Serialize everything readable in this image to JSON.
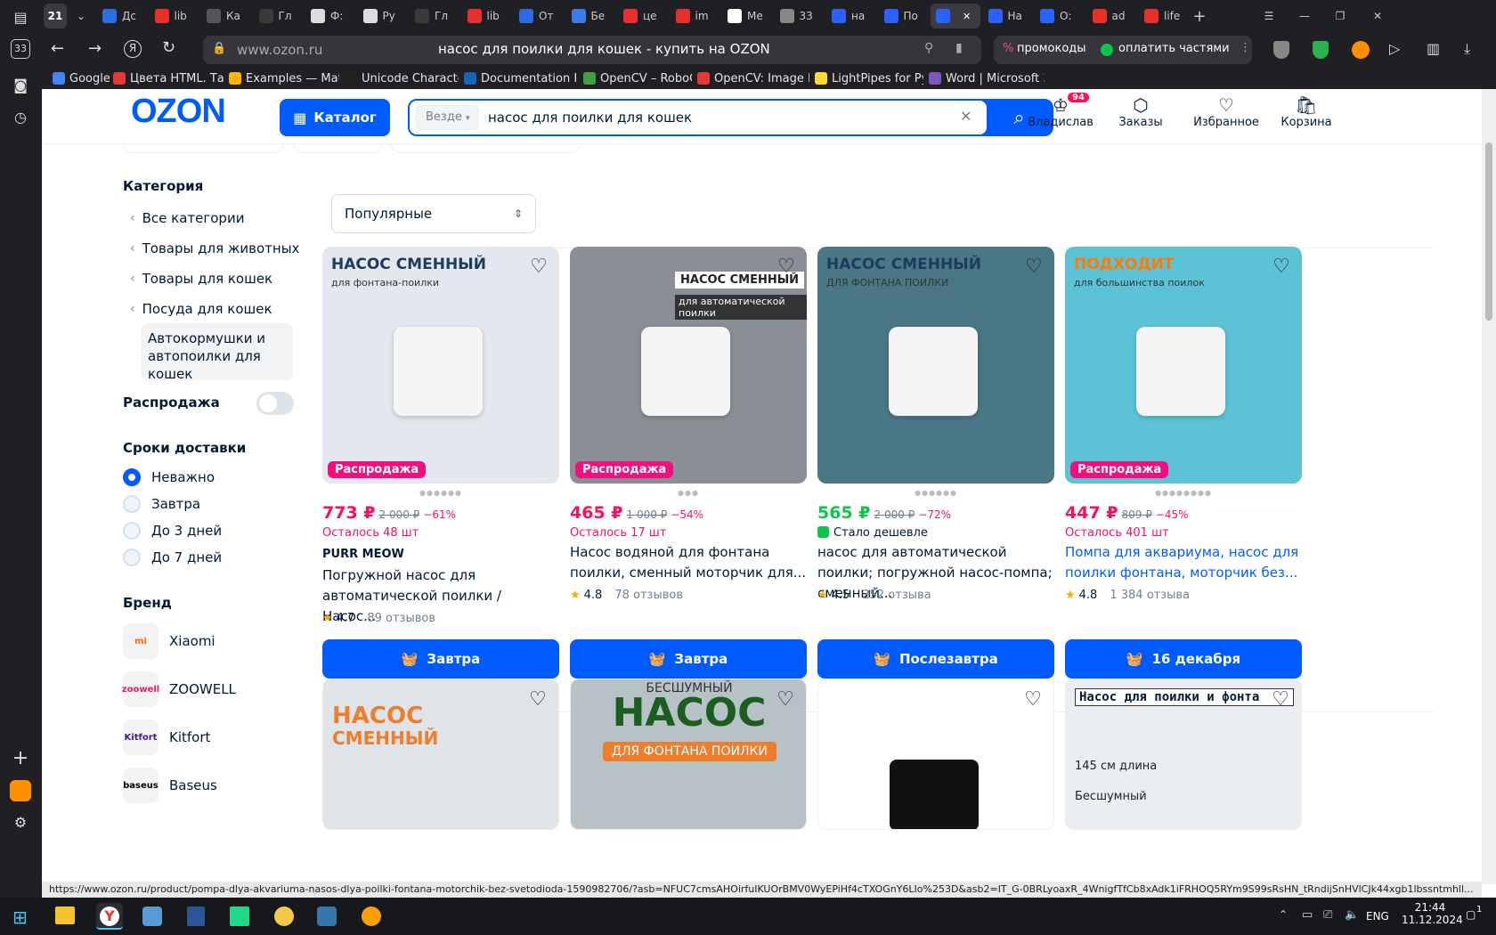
{
  "browser": {
    "tab_count": "21",
    "tabs": [
      {
        "label": "Дс",
        "color": "#2b6fe0"
      },
      {
        "label": "lib",
        "color": "#e5302e"
      },
      {
        "label": "Ка",
        "color": "#555"
      },
      {
        "label": "Гл",
        "color": "#3a3a3a"
      },
      {
        "label": "Ф:",
        "color": "#ddd"
      },
      {
        "label": "Ру",
        "color": "#ddd"
      },
      {
        "label": "Гл",
        "color": "#3a3a3a"
      },
      {
        "label": "lib",
        "color": "#e5302e"
      },
      {
        "label": "От",
        "color": "#2d6cdf"
      },
      {
        "label": "Бе",
        "color": "#3d7be8"
      },
      {
        "label": "це",
        "color": "#e5302e"
      },
      {
        "label": "im",
        "color": "#e5302e"
      },
      {
        "label": "Ме",
        "color": "#fff"
      },
      {
        "label": "33",
        "color": "#888"
      },
      {
        "label": "на",
        "color": "#2962ff"
      },
      {
        "label": "По",
        "color": "#2962ff"
      },
      {
        "label": "",
        "color": "#2962ff"
      },
      {
        "label": "На",
        "color": "#2962ff"
      },
      {
        "label": "О:",
        "color": "#2962ff"
      },
      {
        "label": "ad",
        "color": "#e5302e"
      },
      {
        "label": "life",
        "color": "#e5302e"
      }
    ],
    "domain": "www.ozon.ru",
    "page_title": "насос для поилки для кошек - купить на OZON",
    "promo_label": "промокоды",
    "pay_label": "оплатить частями",
    "bookmarks": [
      {
        "label": "Google",
        "color": "#4285f4"
      },
      {
        "label": "Цвета HTML. Табл",
        "color": "#e53935"
      },
      {
        "label": "Examples — Matpl",
        "color": "#ffb300"
      },
      {
        "label": "Unicode Character",
        "color": "#222"
      },
      {
        "label": "Documentation Int",
        "color": "#1565c0"
      },
      {
        "label": "OpenCV – RoboCr",
        "color": "#43a047"
      },
      {
        "label": "OpenCV: Image Fil",
        "color": "#e53935"
      },
      {
        "label": "LightPipes for Pyth",
        "color": "#fdd835"
      },
      {
        "label": "Word | Microsoft 3",
        "color": "#7e57c2"
      }
    ],
    "status_url": "https://www.ozon.ru/product/pompa-dlya-akvariuma-nasos-dlya-poilki-fontana-motorchik-bez-svetodioda-1590982706/?asb=NFUC7cmsAHOirfuIKUOrBMV0WyEPiHf4cTXOGnY6LIo%253D&asb2=IT_G-0BRLyoaxR_4WnigfTfCb8xAdk1iFRHOQ5RYm9S99sRsHN_tRndijSnHVlCJk44xgb1lbssntmhll...",
    "side_badge": "33"
  },
  "header": {
    "logo": "OZON",
    "catalog": "Каталог",
    "scope": "Везде",
    "search_value": "насос для поилки для кошек",
    "user": "Владислав",
    "user_badge": "94",
    "orders": "Заказы",
    "favorites": "Избранное",
    "cart": "Корзина"
  },
  "filters": {
    "category_title": "Категория",
    "categories": [
      "Все категории",
      "Товары для животных",
      "Товары для кошек",
      "Посуда для кошек"
    ],
    "current_category": "Автокормушки и автопоилки для кошек",
    "sale_label": "Распродажа",
    "delivery_title": "Сроки доставки",
    "delivery_options": [
      "Неважно",
      "Завтра",
      "До 3 дней",
      "До 7 дней"
    ],
    "brand_title": "Бренд",
    "brands": [
      {
        "name": "Xiaomi",
        "logo": "mi",
        "color": "#ff6900"
      },
      {
        "name": "ZOOWELL",
        "logo": "zoowell",
        "color": "#e91e63"
      },
      {
        "name": "Kitfort",
        "logo": "Kitfort",
        "color": "#4a148c"
      },
      {
        "name": "Baseus",
        "logo": "baseus",
        "color": "#000"
      }
    ]
  },
  "sort": {
    "selected": "Популярные"
  },
  "products": [
    {
      "price": "773 ₽",
      "old": "2 000 ₽",
      "disc": "−61%",
      "price_color": "#f91155",
      "left": "Осталось 48 шт",
      "brand": "PURR MEOW",
      "title": "Погружной насос для автоматической поилки / Насос...",
      "rating": "4.7",
      "reviews": "89 отзывов",
      "deliver": "Завтра",
      "sale": "Распродажа",
      "img_text": "НАСОС СМЕННЫЙ",
      "img_sub": "для фонтана-поилки",
      "img_bg": "#e3e8ef",
      "dots": "●●●●●●"
    },
    {
      "price": "465 ₽",
      "old": "1 000 ₽",
      "disc": "−54%",
      "price_color": "#f91155",
      "left": "Осталось 17 шт",
      "brand": "",
      "title": "Насос водяной для фонтана поилки, сменный моторчик для...",
      "rating": "4.8",
      "reviews": "78 отзывов",
      "deliver": "Завтра",
      "sale": "Распродажа",
      "img_text": "НАСОС СМЕННЫЙ",
      "img_sub": "для автоматической поилки",
      "img_bg": "#8a8f96",
      "dots": "●●●"
    },
    {
      "price": "565 ₽",
      "old": "2 000 ₽",
      "disc": "−72%",
      "price_color": "#10c44c",
      "left": "Стало дешевле",
      "brand": "",
      "title": "насос для автоматической поилки; погружной насос-помпа; сменный...",
      "rating": "4.5",
      "reviews": "252 отзыва",
      "deliver": "Послезавтра",
      "sale": "",
      "img_text": "НАСОС СМЕННЫЙ",
      "img_sub": "ДЛЯ ФОНТАНА ПОИЛКИ",
      "img_bg": "#4a7786",
      "dots": "●●●●●●"
    },
    {
      "price": "447 ₽",
      "old": "809 ₽",
      "disc": "−45%",
      "price_color": "#f91155",
      "left": "Осталось 401 шт",
      "brand": "",
      "title": "Помпа для аквариума, насос для поилки фонтана, моторчик без...",
      "rating": "4.8",
      "reviews": "1 384 отзыва",
      "deliver": "16 декабря",
      "sale": "Распродажа",
      "img_text": "ПОДХОДИТ",
      "img_sub": "для большинства поилок",
      "img_bg": "#5cc3d6",
      "dots": "●●●●●●●●"
    }
  ],
  "products_row2": [
    {
      "img_text": "НАСОС",
      "img_sub": "СМЕННЫЙ",
      "img_bg": "#dfe4e8"
    },
    {
      "img_text": "НАСОС",
      "img_sub": "ДЛЯ ФОНТАНА ПОИЛКИ",
      "img_bg": "#b7c2c7",
      "img_top": "БЕСШУМНЫЙ"
    },
    {
      "img_text": "",
      "img_sub": "",
      "img_bg": "#ffffff"
    },
    {
      "img_text": "Насос для поилки и фонта",
      "img_sub": "145 см длина",
      "img_bg": "#eaeef2",
      "img_extra": "Бесшумный"
    }
  ],
  "taskbar": {
    "lang": "ENG",
    "time": "21:44",
    "date": "11.12.2024",
    "notif": "1"
  }
}
